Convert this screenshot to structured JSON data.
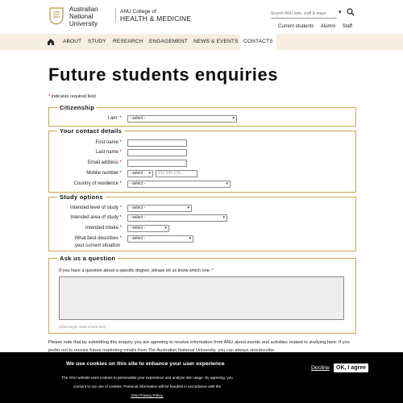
{
  "header": {
    "logo_lines": [
      "Australian",
      "National",
      "University"
    ],
    "college_line1": "ANU College of",
    "college_line2": "HEALTH & MEDICINE",
    "search_placeholder": "Search ANU web, staff & maps",
    "util_links": [
      "Current students",
      "Alumni",
      "Staff"
    ]
  },
  "nav": {
    "items": [
      "ABOUT",
      "STUDY",
      "RESEARCH",
      "ENGAGEMENT",
      "NEWS & EVENTS",
      "CONTACTS"
    ],
    "active": "CONTACTS"
  },
  "page": {
    "title": "Future students enquiries",
    "required_note": "indicates required field"
  },
  "citizenship": {
    "legend": "Citizenship",
    "i_am_label": "I am:",
    "i_am_value": "- select -"
  },
  "contact": {
    "legend": "Your contact details",
    "first_name_label": "First name",
    "last_name_label": "Last name",
    "email_label": "Email address",
    "mobile_label": "Mobile number",
    "mobile_code_value": "- select -",
    "mobile_placeholder": "412 345 678",
    "country_label": "Country of residence",
    "country_value": "- select -"
  },
  "study": {
    "legend": "Study options",
    "level_label": "Intended level of study",
    "level_value": "- select -",
    "area_label": "Intended area of study",
    "area_value": "- select -",
    "intake_label": "Intended intake",
    "intake_value": "- select -",
    "describes_label_1": "What best describes",
    "describes_label_2": "your current situation",
    "describes_value": "- select -"
  },
  "ask": {
    "legend": "Ask us a question",
    "prompt": "If you have a question about a specific degree, please let us know which one.",
    "maxlength_note": "(Max length 1500 characters)"
  },
  "notice": "Please note that by submitting this enquiry you are agreeing to receive information from ANU about events and activities related to studying here. If you prefer not to receive future marketing emails from The Australian National University, you can always unsubscribe",
  "cookie": {
    "title": "We use cookies on this site to enhance your user experience",
    "body_line1": "The ANU website uses cookies to personalise your experience and analyse site usage. By agreeing, you",
    "body_line2": "consent to our use of cookies. Personal information will be handled in accordance with the",
    "link": "ANU Privacy Policy.",
    "decline_label": "Decline",
    "ok_label": "OK, I agree"
  },
  "colors": {
    "accent_gold": "#c9a84c",
    "nav_bg": "#f5eee1",
    "required_red": "#cc0000"
  }
}
